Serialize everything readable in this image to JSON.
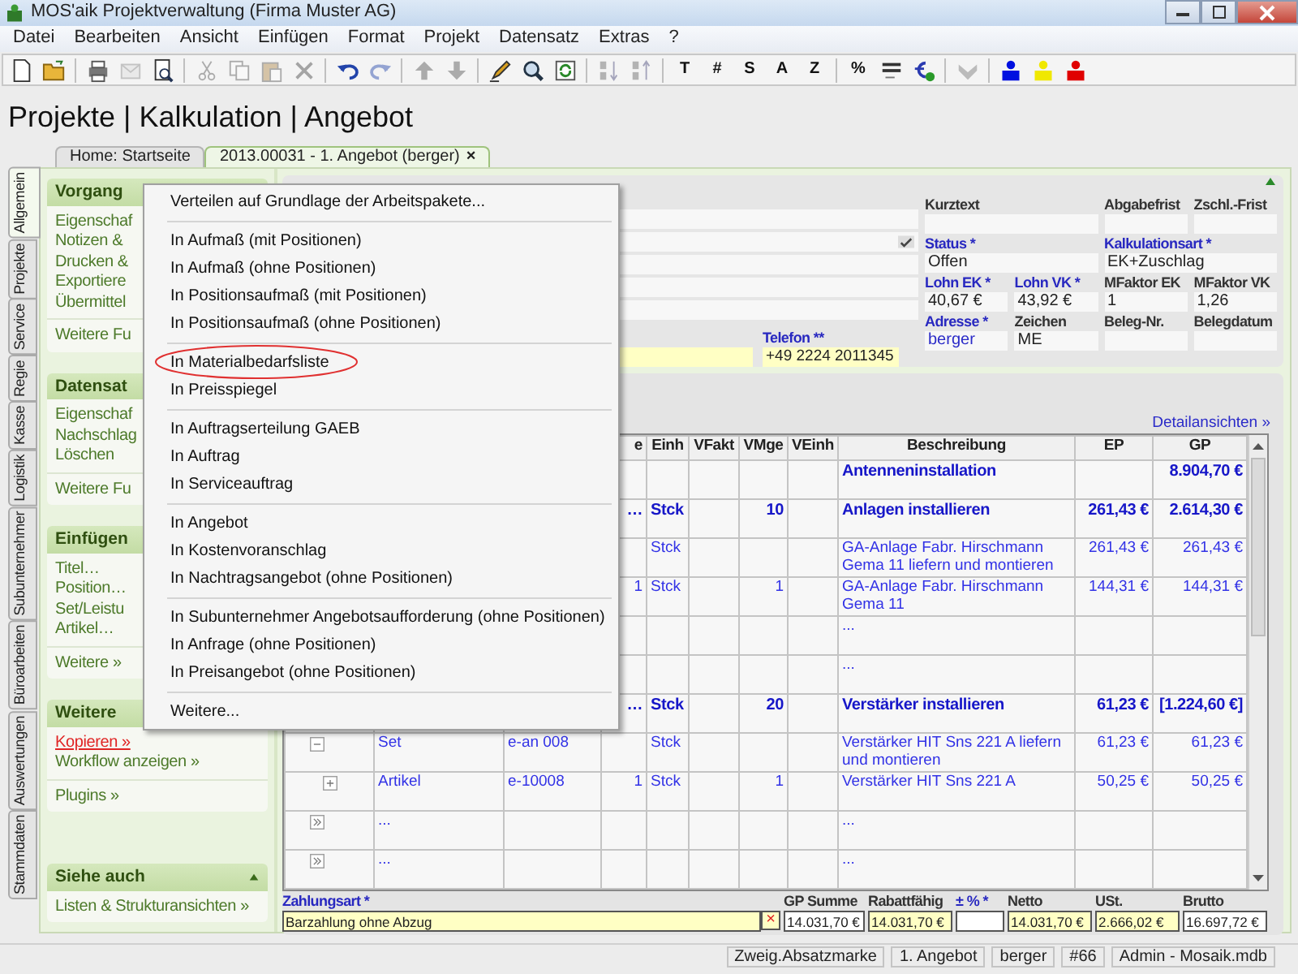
{
  "window": {
    "title": "MOS'aik Projektverwaltung (Firma Muster AG)"
  },
  "menubar": [
    "Datei",
    "Bearbeiten",
    "Ansicht",
    "Einfügen",
    "Format",
    "Projekt",
    "Datensatz",
    "Extras",
    "?"
  ],
  "toolbar": [
    {
      "kind": "icon",
      "disabled": false
    },
    {
      "kind": "icon",
      "disabled": false
    },
    {
      "kind": "separator"
    },
    {
      "kind": "icon",
      "disabled": false
    },
    {
      "kind": "icon",
      "disabled": true
    },
    {
      "kind": "icon",
      "disabled": false
    },
    {
      "kind": "separator"
    },
    {
      "kind": "icon",
      "disabled": true
    },
    {
      "kind": "icon",
      "disabled": true
    },
    {
      "kind": "icon",
      "disabled": true
    },
    {
      "kind": "icon",
      "disabled": true
    },
    {
      "kind": "separator"
    },
    {
      "kind": "icon",
      "disabled": false
    },
    {
      "kind": "icon",
      "disabled": true
    },
    {
      "kind": "separator"
    },
    {
      "kind": "icon",
      "disabled": true
    },
    {
      "kind": "icon",
      "disabled": true
    },
    {
      "kind": "separator"
    },
    {
      "kind": "icon",
      "disabled": false
    },
    {
      "kind": "icon",
      "disabled": false
    },
    {
      "kind": "icon",
      "disabled": false
    },
    {
      "kind": "separator"
    },
    {
      "kind": "icon",
      "disabled": true
    },
    {
      "kind": "icon",
      "disabled": true
    },
    {
      "kind": "separator"
    },
    {
      "kind": "text",
      "label": "T",
      "disabled": false
    },
    {
      "kind": "text",
      "label": "#",
      "disabled": false
    },
    {
      "kind": "text",
      "label": "S",
      "disabled": false
    },
    {
      "kind": "text",
      "label": "A",
      "disabled": false
    },
    {
      "kind": "text",
      "label": "Z",
      "disabled": false
    },
    {
      "kind": "separator"
    },
    {
      "kind": "text",
      "label": "%",
      "disabled": false
    },
    {
      "kind": "icon",
      "disabled": false
    },
    {
      "kind": "icon",
      "disabled": false
    },
    {
      "kind": "separator"
    },
    {
      "kind": "icon",
      "disabled": true
    },
    {
      "kind": "separator"
    },
    {
      "kind": "person",
      "color": "#0010e0"
    },
    {
      "kind": "person",
      "color": "#f0e800"
    },
    {
      "kind": "person",
      "color": "#e00000"
    }
  ],
  "heading": "Projekte | Kalkulation | Angebot",
  "tabs": [
    {
      "label": "Home: Startseite",
      "selected": false
    },
    {
      "label": "2013.00031 - 1. Angebot (berger)",
      "selected": true,
      "close": "×"
    }
  ],
  "side_tabs": [
    {
      "label": "Allgemein",
      "selected": true
    },
    {
      "label": "Projekte",
      "selected": false
    },
    {
      "label": "Service",
      "selected": false
    },
    {
      "label": "Regie",
      "selected": false
    },
    {
      "label": "Kasse",
      "selected": false
    },
    {
      "label": "Logistik",
      "selected": false
    },
    {
      "label": "Subunternehmer",
      "selected": false
    },
    {
      "label": "Büroarbeiten",
      "selected": false
    },
    {
      "label": "Auswertungen",
      "selected": false
    },
    {
      "label": "Stammdaten",
      "selected": false
    }
  ],
  "sidebar": [
    {
      "title": "Vorgang",
      "groups": [
        [
          {
            "label": "Eigenschaf",
            "active": false
          },
          {
            "label": "Notizen &",
            "active": false
          },
          {
            "label": "Drucken &",
            "active": false
          },
          {
            "label": "Exportiere",
            "active": false
          },
          {
            "label": "Übermittel",
            "active": false
          }
        ],
        [
          {
            "label": "Weitere Fu",
            "active": false
          }
        ]
      ]
    },
    {
      "title": "Datensat",
      "groups": [
        [
          {
            "label": "Eigenschaf",
            "active": false
          },
          {
            "label": "Nachschlag",
            "active": false
          },
          {
            "label": "Löschen",
            "active": false
          }
        ],
        [
          {
            "label": "Weitere Fu",
            "active": false
          }
        ]
      ]
    },
    {
      "title": "Einfügen",
      "groups": [
        [
          {
            "label": "Titel…",
            "active": false
          },
          {
            "label": "Position…",
            "active": false
          },
          {
            "label": "Set/Leistu",
            "active": false
          },
          {
            "label": "Artikel…",
            "active": false
          }
        ],
        [
          {
            "label": "Weitere »",
            "active": false
          }
        ]
      ]
    },
    {
      "title": "Weitere",
      "groups": [
        [
          {
            "label": "Kopieren »",
            "active": true
          },
          {
            "label": "Workflow anzeigen »",
            "active": false
          }
        ],
        [
          {
            "label": "Plugins »",
            "active": false
          }
        ]
      ]
    },
    {
      "title": "Siehe auch",
      "collapsible": true,
      "groups": [
        [
          {
            "label": "Listen & Strukturansichten »",
            "active": false
          }
        ]
      ]
    }
  ],
  "header": {
    "left_fields": [
      {
        "lookup": false
      },
      {
        "lookup": true
      },
      {
        "lookup": false
      },
      {
        "lookup": false
      },
      {
        "lookup": false
      }
    ],
    "customer_field": {
      "highlighted": true
    },
    "telefon": {
      "label": "Telefon **",
      "required": true,
      "value": "+49 2224 2011345",
      "highlighted": true
    },
    "rows": [
      [
        {
          "label": "Kurztext",
          "required": false
        },
        "",
        {
          "label": "Abgabefrist",
          "required": false
        },
        {
          "label": "Zschl.-Frist",
          "required": false
        }
      ],
      [
        {
          "label": "Status *",
          "required": true,
          "value": "Offen"
        },
        "",
        {
          "label": "Kalkulationsart *",
          "required": true,
          "value": "EK+Zuschlag"
        },
        ""
      ],
      [
        {
          "label": "Lohn EK *",
          "required": true,
          "value": "40,67 €"
        },
        {
          "label": "Lohn VK *",
          "required": true,
          "value": "43,92 €"
        },
        {
          "label": "MFaktor EK",
          "required": false,
          "value": "1"
        },
        {
          "label": "MFaktor VK",
          "required": false,
          "value": "1,26"
        }
      ],
      [
        {
          "label": "Adresse *",
          "required": true,
          "value": "berger",
          "link": true
        },
        {
          "label": "Zeichen",
          "required": false,
          "value": "ME",
          "link": false
        },
        {
          "label": "Beleg-Nr.",
          "required": false
        },
        {
          "label": "Belegdatum",
          "required": false
        }
      ]
    ]
  },
  "table": {
    "link": "Detailansichten »",
    "columns": [
      "e",
      "Einh",
      "VFakt",
      "VMge",
      "VEinh",
      "Beschreibung",
      "EP",
      "GP"
    ],
    "rows": [
      {
        "kind": "title",
        "beschreibung": "Antenneninstallation",
        "gp": "8.904,70 €"
      },
      {
        "kind": "position",
        "mge": "…",
        "einh": "Stck",
        "vmge": "10",
        "beschreibung": "Anlagen installieren",
        "ep": "261,43 €",
        "gp": "2.614,30 €"
      },
      {
        "kind": "item",
        "einh": "Stck",
        "beschreibung": "GA-Anlage Fabr. Hirschmann Gema 11 liefern und montieren",
        "ep": "261,43 €",
        "gp": "261,43 €"
      },
      {
        "kind": "item",
        "mge": "1",
        "einh": "Stck",
        "vmge": "1",
        "beschreibung": "GA-Anlage Fabr. Hirschmann Gema 11",
        "ep": "144,31 €",
        "gp": "144,31 €"
      },
      {
        "kind": "empty",
        "beschreibung": "..."
      },
      {
        "kind": "empty",
        "beschreibung": "..."
      },
      {
        "kind": "position",
        "mge": "…",
        "einh": "Stck",
        "vmge": "20",
        "beschreibung": "Verstärker installieren",
        "ep": "61,23 €",
        "gp": "[1.224,60 €]"
      },
      {
        "kind": "item",
        "node_expanded": true,
        "type": "Set",
        "number": "e-an 008",
        "einh": "Stck",
        "beschreibung": "Verstärker HIT Sns 221 A liefern und montieren",
        "ep": "61,23 €",
        "gp": "61,23 €"
      },
      {
        "kind": "item",
        "node_expanded": false,
        "type": "Artikel",
        "number": "e-10008",
        "mge": "1",
        "einh": "Stck",
        "vmge": "1",
        "beschreibung": "Verstärker HIT Sns 221 A",
        "ep": "50,25 €",
        "gp": "50,25 €"
      },
      {
        "kind": "empty",
        "more_button": true,
        "type": "...",
        "beschreibung": "..."
      },
      {
        "kind": "empty",
        "more_button": true,
        "type": "...",
        "beschreibung": "..."
      }
    ]
  },
  "summary": {
    "payment": {
      "label": "Zahlungsart *",
      "required": true,
      "value": "Barzahlung ohne Abzug",
      "highlighted": true,
      "clear": "×"
    },
    "fields": [
      {
        "label": "GP Summe",
        "required": false,
        "value": "14.031,70 €",
        "highlighted": false
      },
      {
        "label": "Rabattfähig",
        "required": false,
        "value": "14.031,70 €",
        "highlighted": true
      },
      {
        "label": "± % *",
        "required": true,
        "highlighted": false
      },
      {
        "label": "Netto",
        "required": false,
        "value": "14.031,70 €",
        "highlighted": true
      },
      {
        "label": "USt.",
        "required": false,
        "value": "2.666,02 €",
        "highlighted": true
      },
      {
        "label": "Brutto",
        "required": false,
        "value": "16.697,72 €",
        "highlighted": false
      }
    ]
  },
  "context_menu": [
    [
      {
        "label": "Verteilen auf Grundlage der Arbeitspakete...",
        "circled": false
      }
    ],
    [
      {
        "label": "In Aufmaß (mit Positionen)",
        "circled": false
      },
      {
        "label": "In Aufmaß (ohne Positionen)",
        "circled": false
      },
      {
        "label": "In Positionsaufmaß (mit Positionen)",
        "circled": false
      },
      {
        "label": "In Positionsaufmaß (ohne Positionen)",
        "circled": false
      }
    ],
    [
      {
        "label": "In Materialbedarfsliste",
        "circled": true
      },
      {
        "label": "In Preisspiegel",
        "circled": false
      }
    ],
    [
      {
        "label": "In Auftragserteilung GAEB",
        "circled": false
      },
      {
        "label": "In Auftrag",
        "circled": false
      },
      {
        "label": "In Serviceauftrag",
        "circled": false
      }
    ],
    [
      {
        "label": "In Angebot",
        "circled": false
      },
      {
        "label": "In Kostenvoranschlag",
        "circled": false
      },
      {
        "label": "In Nachtragsangebot (ohne Positionen)",
        "circled": false
      }
    ],
    [
      {
        "label": "In Subunternehmer Angebotsaufforderung (ohne Positionen)",
        "circled": false
      },
      {
        "label": "In Anfrage (ohne Positionen)",
        "circled": false
      },
      {
        "label": "In Preisangebot (ohne Positionen)",
        "circled": false
      }
    ],
    [
      {
        "label": "Weitere...",
        "circled": false
      }
    ]
  ],
  "status_bar": [
    "Zweig.Absatzmarke",
    "1. Angebot",
    "berger",
    "#66",
    "Admin - Mosaik.mdb"
  ]
}
